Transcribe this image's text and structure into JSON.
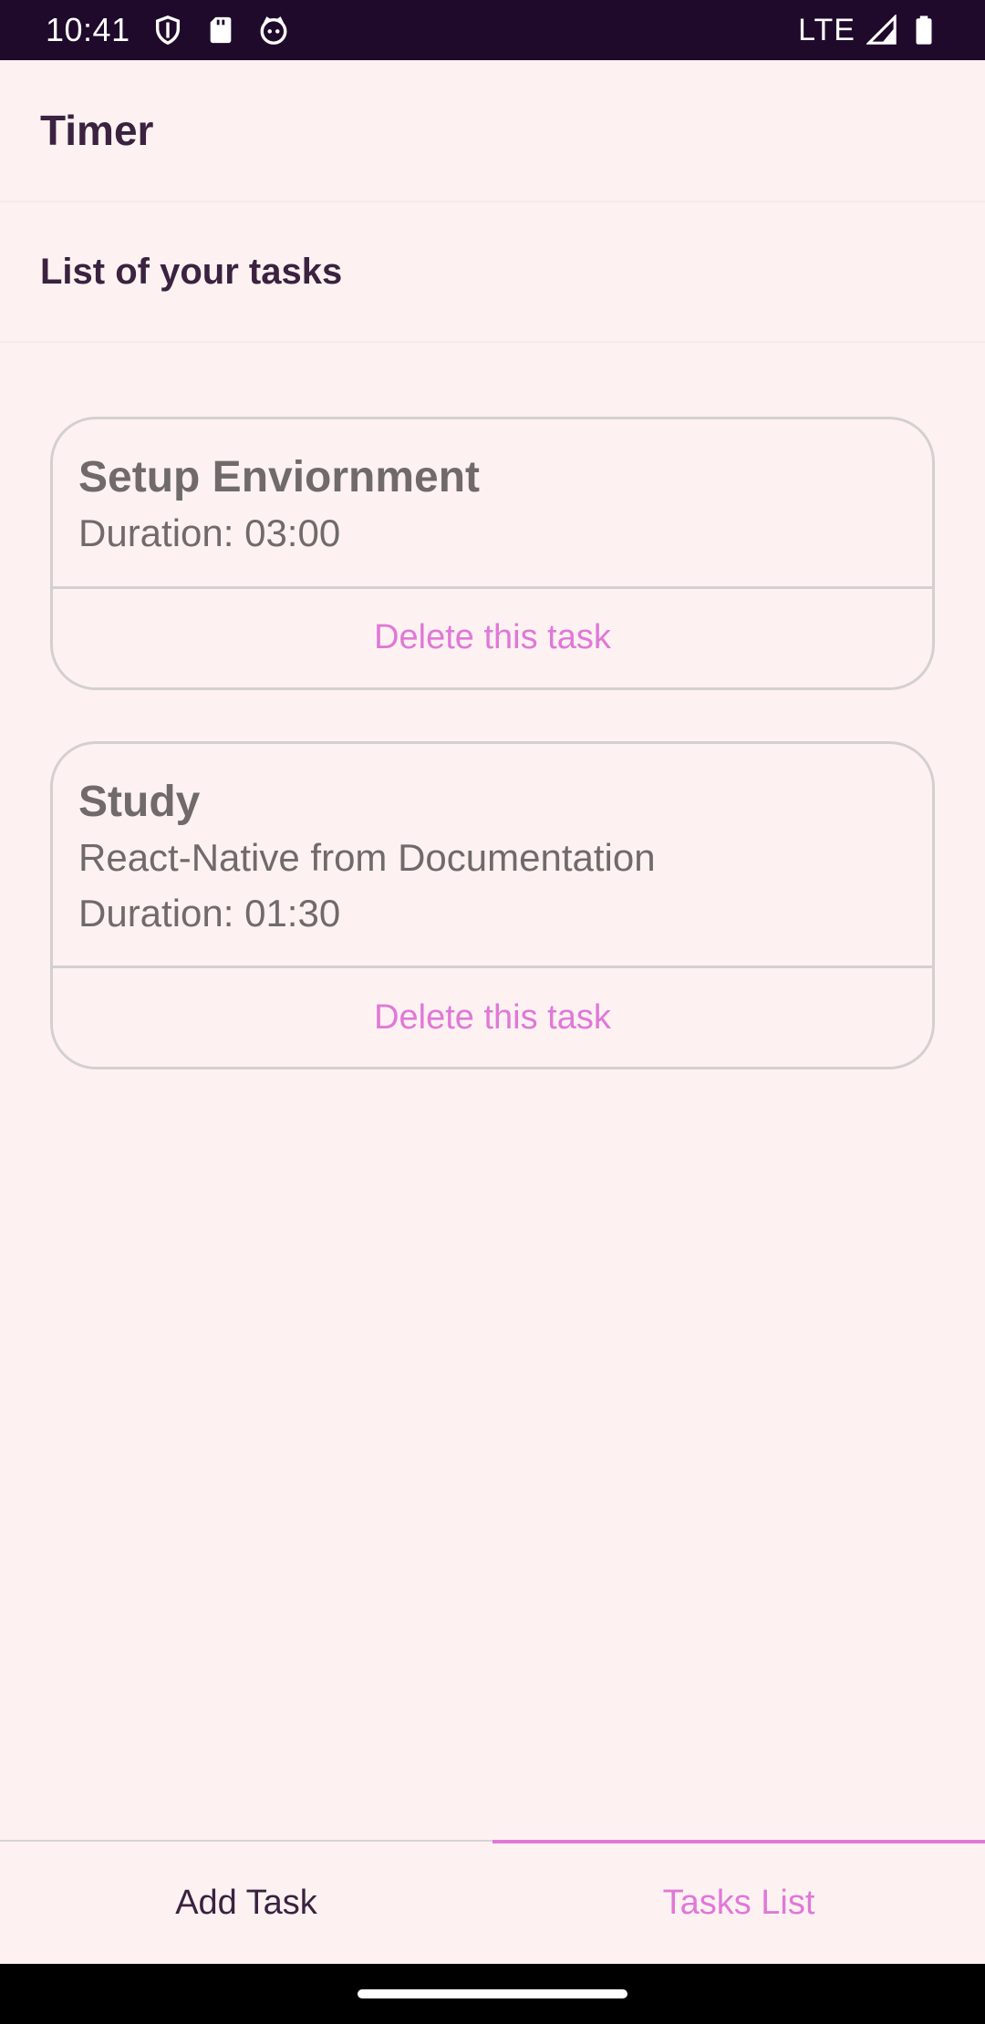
{
  "status_bar": {
    "time": "10:41",
    "network": "LTE",
    "icons": [
      "shield-icon",
      "sd-card-icon",
      "face-icon",
      "signal-icon",
      "battery-icon"
    ]
  },
  "header": {
    "title": "Timer"
  },
  "section": {
    "title": "List of your tasks"
  },
  "tasks": [
    {
      "title": "Setup Enviornment",
      "description": "",
      "duration": "Duration: 03:00",
      "delete_label": "Delete this task"
    },
    {
      "title": "Study",
      "description": "React-Native from Documentation",
      "duration": "Duration: 01:30",
      "delete_label": "Delete this task"
    }
  ],
  "tabs": {
    "add_task": "Add Task",
    "tasks_list": "Tasks List",
    "active": "tasks_list"
  },
  "colors": {
    "background": "#fdf2f1",
    "status_bar": "#1f0a2b",
    "title_text": "#3b2240",
    "task_text": "#706a6a",
    "accent": "#e078d8",
    "border": "#d4d0d0"
  }
}
